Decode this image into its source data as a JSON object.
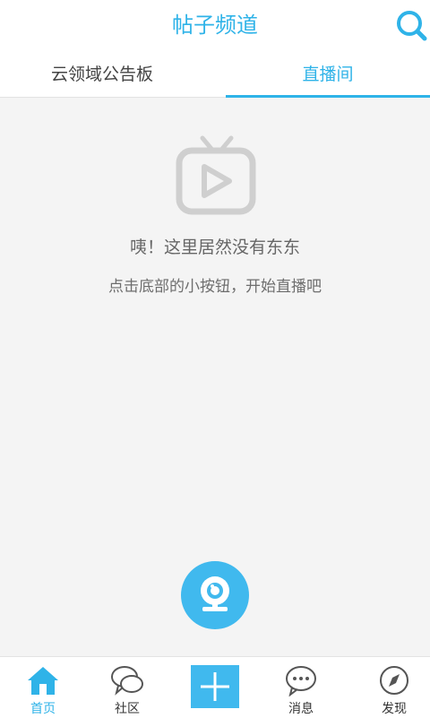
{
  "header": {
    "title": "帖子频道"
  },
  "tabs": [
    {
      "label": "云领域公告板"
    },
    {
      "label": "直播间"
    }
  ],
  "empty_state": {
    "message": "咦！这里居然没有东东",
    "hint": "点击底部的小按钮，开始直播吧"
  },
  "bottom_nav": [
    {
      "label": "首页"
    },
    {
      "label": "社区"
    },
    {
      "label": "消息"
    },
    {
      "label": "发现"
    }
  ],
  "colors": {
    "accent": "#2fb3e8",
    "background": "#f4f4f4",
    "illustration": "#cfcfcf"
  }
}
